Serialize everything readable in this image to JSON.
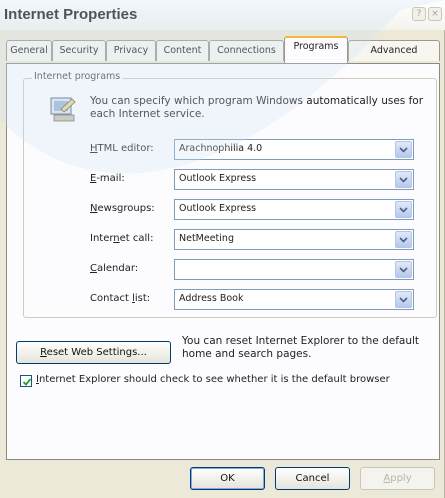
{
  "window": {
    "title": "Internet Properties",
    "help_glyph": "?",
    "close_glyph": "×"
  },
  "tabs": [
    {
      "label": "General",
      "active": false
    },
    {
      "label": "Security",
      "active": false
    },
    {
      "label": "Privacy",
      "active": false
    },
    {
      "label": "Content",
      "active": false
    },
    {
      "label": "Connections",
      "active": false
    },
    {
      "label": "Programs",
      "active": true
    },
    {
      "label": "Advanced",
      "active": false
    }
  ],
  "programs": {
    "group_title": "Internet programs",
    "description": "You can specify which program Windows automatically uses for each Internet service.",
    "rows": [
      {
        "label_access": "H",
        "label_rest": "TML editor:",
        "value": "Arachnophilia 4.0"
      },
      {
        "label_access": "E",
        "label_rest": "-mail:",
        "value": "Outlook Express"
      },
      {
        "label_access": "N",
        "label_rest": "ewsgroups:",
        "value": "Outlook Express"
      },
      {
        "label_pre": "Inter",
        "label_access": "n",
        "label_rest": "et call:",
        "value": "NetMeeting"
      },
      {
        "label_access": "C",
        "label_rest": "alendar:",
        "value": ""
      },
      {
        "label_pre": "Contact ",
        "label_access": "l",
        "label_rest": "ist:",
        "value": "Address Book"
      }
    ]
  },
  "reset": {
    "button_access": "R",
    "button_rest": "eset Web Settings...",
    "description": "You can reset Internet Explorer to the default home and search pages."
  },
  "default_check": {
    "checked": true,
    "label_access": "I",
    "label_rest": "nternet Explorer should check to see whether it is the default browser"
  },
  "footer": {
    "ok_label": "OK",
    "cancel_label": "Cancel",
    "apply_access": "A",
    "apply_rest": "pply"
  },
  "colors": {
    "dialog_bg": "#ece9d8",
    "panel_bg": "#fcfcfe",
    "active_tab_accent": "#f4b73a",
    "input_border": "#7f9db9",
    "button_border": "#003c74"
  }
}
